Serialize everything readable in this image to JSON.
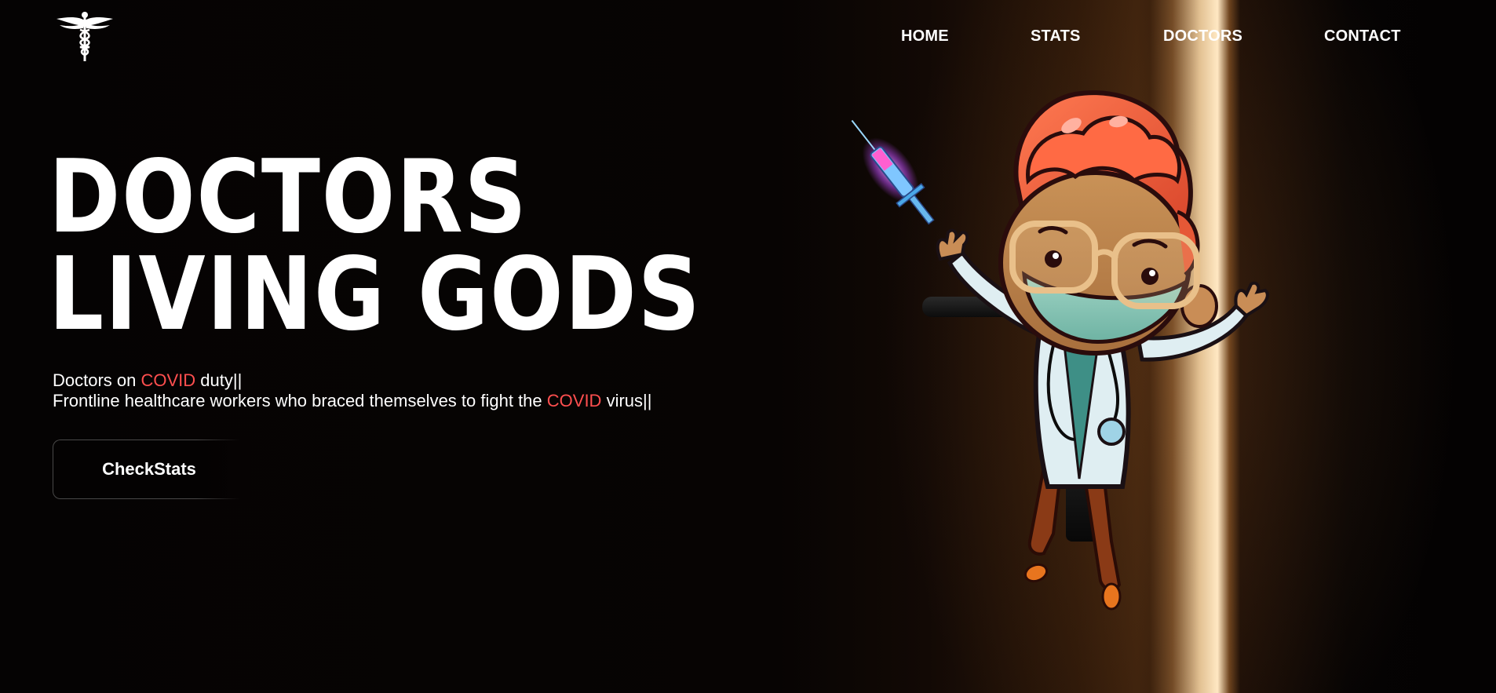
{
  "header": {
    "logo_icon": "caduceus-icon",
    "nav": [
      {
        "label": "HOME"
      },
      {
        "label": "STATS"
      },
      {
        "label": "DOCTORS"
      },
      {
        "label": "CONTACT"
      }
    ]
  },
  "hero": {
    "title_line1": "DOCTORS",
    "title_line2": "LIVING GODS",
    "subtitle1": {
      "before": "Doctors on ",
      "highlight": "COVID",
      "after": " duty||"
    },
    "subtitle2": {
      "before": "Frontline healthcare workers who braced themselves to fight the ",
      "highlight": "COVID",
      "after": " virus||"
    },
    "cta_label": "CheckStats",
    "illustration_icon": "cartoon-doctor-with-syringe-icon"
  },
  "colors": {
    "background": "#060303",
    "text": "#ffffff",
    "accent": "#ff4f4f",
    "door_light": "#ffe8c3"
  }
}
